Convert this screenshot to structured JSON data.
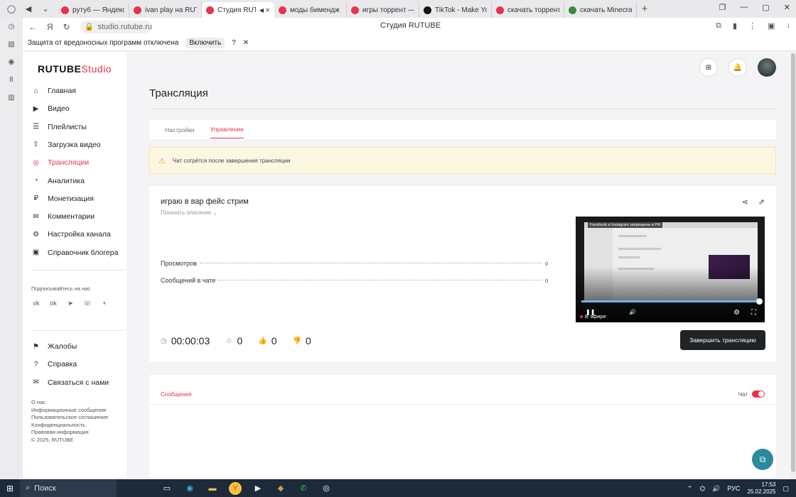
{
  "browser": {
    "tabs": [
      {
        "label": "рутуб — Яндекс: н",
        "color": "#e8324e",
        "icon": "yandex-icon"
      },
      {
        "label": "ivan play на RUTUB",
        "color": "#e8324e",
        "icon": "rutube-icon"
      },
      {
        "label": "Студия RUTUB",
        "color": "#e8324e",
        "icon": "rutube-icon",
        "active": true
      },
      {
        "label": "моды бимендж р",
        "color": "#e8324e",
        "icon": "yandex-icon"
      },
      {
        "label": "игры торрент — Я",
        "color": "#e8324e",
        "icon": "yandex-icon"
      },
      {
        "label": "TikTok - Make You",
        "color": "#111111",
        "icon": "tiktok-icon"
      },
      {
        "label": "скачать торрент м",
        "color": "#e8324e",
        "icon": "yandex-icon"
      },
      {
        "label": "скачать Minecraft",
        "color": "#3c8a3c",
        "icon": "minecraft-icon"
      }
    ],
    "url": "studio.rutube.ru",
    "page_title": "Студия RUTUBE",
    "infobar": {
      "text": "Защита от вредоносных программ отключена",
      "button": "Включить"
    }
  },
  "logo": {
    "main": "RUTUBE",
    "sub": "Studio"
  },
  "sidebar": {
    "items": [
      {
        "label": "Главная",
        "icon": "home-icon"
      },
      {
        "label": "Видео",
        "icon": "play-icon"
      },
      {
        "label": "Плейлисты",
        "icon": "list-icon"
      },
      {
        "label": "Загрузка видео",
        "icon": "upload-icon"
      },
      {
        "label": "Трансляции",
        "icon": "broadcast-icon",
        "active": true
      },
      {
        "label": "Аналитика",
        "icon": "analytics-icon"
      },
      {
        "label": "Монетизация",
        "icon": "money-icon"
      },
      {
        "label": "Комментарии",
        "icon": "comment-icon"
      },
      {
        "label": "Настройка канала",
        "icon": "settings-icon"
      },
      {
        "label": "Справочник блогера",
        "icon": "book-icon"
      }
    ],
    "subscribe_label": "Подписывайтесь на нас",
    "bottom_items": [
      {
        "label": "Жалобы",
        "icon": "flag-icon"
      },
      {
        "label": "Справка",
        "icon": "help-icon"
      },
      {
        "label": "Связаться с нами",
        "icon": "mail-icon"
      }
    ],
    "footer_links": [
      "О нас",
      "Информационные сообщения",
      "Пользовательское соглашение",
      "Конфиденциальность",
      "Правовая информация",
      "© 2025, RUTUBE"
    ]
  },
  "main": {
    "title": "Трансляция",
    "tabs": [
      "Настройки",
      "Управление"
    ],
    "warning": "Чат сотрётся после завершения трансляции",
    "stream": {
      "title": "играю в вар фейс стрим",
      "show_description": "Показать описание",
      "stats": [
        {
          "label": "Просмотров",
          "value": "0"
        },
        {
          "label": "Сообщений в чате",
          "value": "0"
        }
      ],
      "timer": "00:00:03",
      "viewers": "0",
      "likes": "0",
      "dislikes": "0",
      "end_button": "Завершить трансляцию",
      "player": {
        "live_label": "В эфире",
        "banner": "Facebook и Instagram запрещены в РФ",
        "progress": 1.0
      }
    },
    "chat": {
      "tab_label": "Сообщения",
      "toggle_label": "Чат",
      "enabled": true
    }
  },
  "taskbar": {
    "search": "Поиск",
    "lang": "РУС",
    "time": "17:53",
    "date": "25.02.2025"
  },
  "colors": {
    "accent": "#e8324e",
    "dark_button": "#1f2326"
  }
}
